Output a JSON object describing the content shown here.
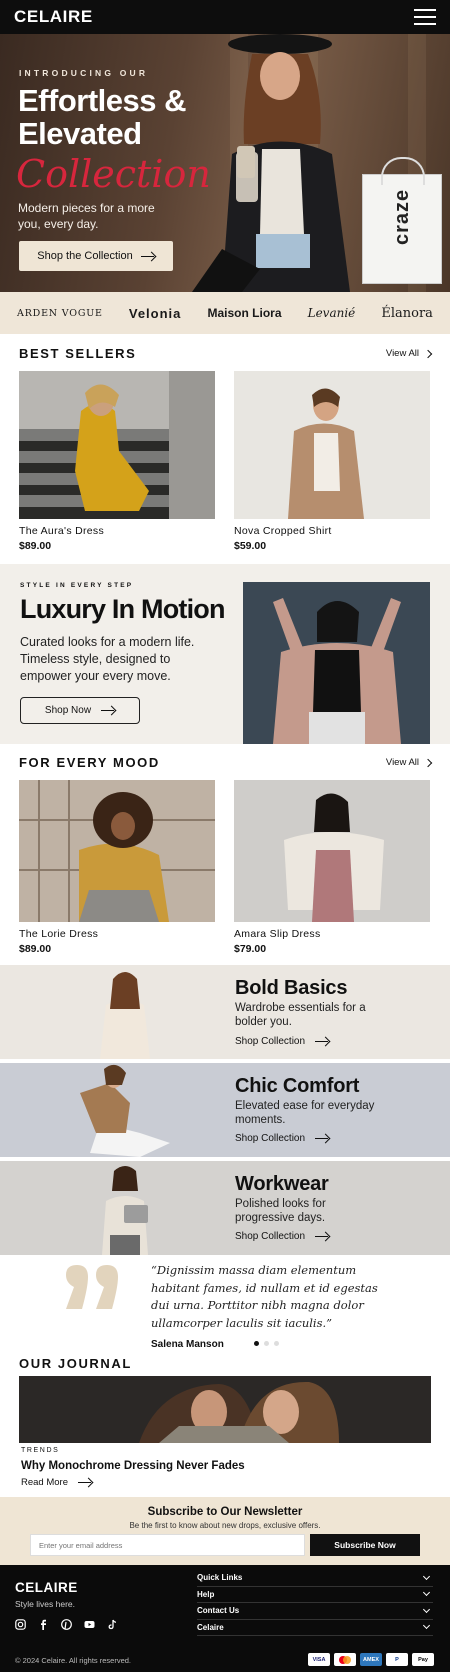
{
  "header": {
    "logo": "CELAIRE",
    "menu_icon": "hamburger-menu-icon"
  },
  "hero": {
    "kicker": "INTRODUCING OUR",
    "title_line1": "Effortless &",
    "title_line2": "Elevated",
    "script": "Collection",
    "subtitle": "Modern pieces for a more you, every day.",
    "cta": "Shop the Collection",
    "bag_text": "craze"
  },
  "brands": [
    "ARDEN VOGUE",
    "Velonia",
    "Maison Liora",
    "Levanié",
    "Élanora"
  ],
  "best_sellers": {
    "title": "BEST SELLERS",
    "view_all": "View All",
    "products": [
      {
        "name": "The Aura's Dress",
        "price": "$89.00"
      },
      {
        "name": "Nova Cropped Shirt",
        "price": "$59.00"
      }
    ]
  },
  "luxury": {
    "kicker": "STYLE IN EVERY STEP",
    "title": "Luxury In Motion",
    "text": "Curated looks for a modern life. Timeless style, designed to empower your every move.",
    "cta": "Shop Now"
  },
  "every_mood": {
    "title": "FOR EVERY MOOD",
    "view_all": "View All",
    "products": [
      {
        "name": "The Lorie Dress",
        "price": "$89.00"
      },
      {
        "name": "Amara Slip Dress",
        "price": "$79.00"
      }
    ]
  },
  "categories": [
    {
      "title": "Bold Basics",
      "desc": "Wardrobe essentials for a bolder you.",
      "link": "Shop Collection"
    },
    {
      "title": "Chic Comfort",
      "desc": "Elevated ease for everyday moments.",
      "link": "Shop Collection"
    },
    {
      "title": "Workwear",
      "desc": "Polished looks for progressive days.",
      "link": "Shop Collection"
    }
  ],
  "testimonial": {
    "quote": "“Dignissim massa diam elementum habitant fames, id nullam et id egestas dui urna. Porttitor nibh magna dolor ullamcorper laculis sit iaculis.”",
    "author": "Salena Manson"
  },
  "journal": {
    "title": "OUR JOURNAL",
    "tag": "TRENDS",
    "post_title": "Why Monochrome Dressing Never Fades",
    "link": "Read More"
  },
  "newsletter": {
    "title": "Subscribe to Our Newsletter",
    "subtitle": "Be the first to know about new drops, exclusive offers.",
    "placeholder": "Enter your email address",
    "button": "Subscribe Now"
  },
  "footer": {
    "logo": "CELAIRE",
    "tagline": "Style lives here.",
    "links": [
      "Quick Links",
      "Help",
      "Contact Us",
      "Celaire"
    ],
    "copyright": "© 2024 Celaire. All rights reserved.",
    "payments": [
      "VISA",
      "MC",
      "AMEX",
      "PayPal",
      "Apple Pay"
    ]
  },
  "colors": {
    "dark": "#0d0d0d",
    "beige": "#efe6d8",
    "accent": "#d7263d"
  }
}
